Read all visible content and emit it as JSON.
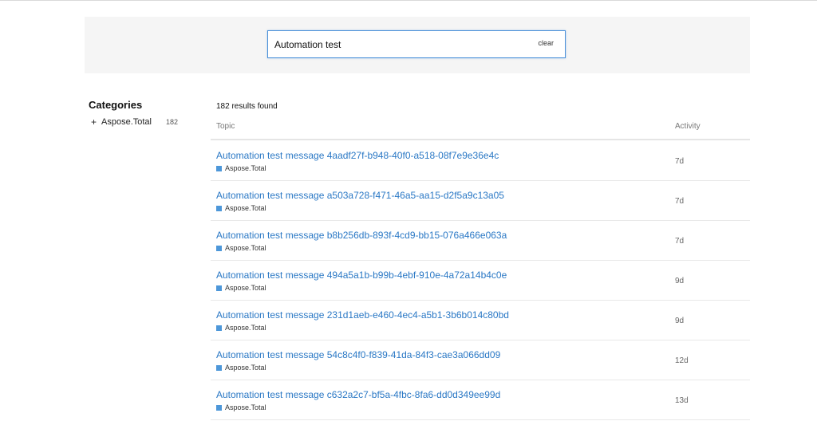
{
  "search": {
    "value": "Automation test",
    "clear_label": "clear"
  },
  "sidebar": {
    "title": "Categories",
    "categories": [
      {
        "label": "Aspose.Total",
        "count": "182"
      }
    ]
  },
  "results": {
    "count_text": "182 results found",
    "columns": {
      "topic": "Topic",
      "activity": "Activity"
    },
    "rows": [
      {
        "title": "Automation test message 4aadf27f-b948-40f0-a518-08f7e9e36e4c",
        "category": "Aspose.Total",
        "activity": "7d"
      },
      {
        "title": "Automation test message a503a728-f471-46a5-aa15-d2f5a9c13a05",
        "category": "Aspose.Total",
        "activity": "7d"
      },
      {
        "title": "Automation test message b8b256db-893f-4cd9-bb15-076a466e063a",
        "category": "Aspose.Total",
        "activity": "7d"
      },
      {
        "title": "Automation test message 494a5a1b-b99b-4ebf-910e-4a72a14b4c0e",
        "category": "Aspose.Total",
        "activity": "9d"
      },
      {
        "title": "Automation test message 231d1aeb-e460-4ec4-a5b1-3b6b014c80bd",
        "category": "Aspose.Total",
        "activity": "9d"
      },
      {
        "title": "Automation test message 54c8c4f0-f839-41da-84f3-cae3a066dd09",
        "category": "Aspose.Total",
        "activity": "12d"
      },
      {
        "title": "Automation test message c632a2c7-bf5a-4fbc-8fa6-dd0d349ee99d",
        "category": "Aspose.Total",
        "activity": "13d"
      }
    ]
  },
  "colors": {
    "link": "#2a78c5",
    "category_swatch": "#4d97d9",
    "search_border": "#4a90d9",
    "panel_bg": "#f5f5f5"
  },
  "icons": {
    "category_expand": "plus-icon",
    "category_marker": "square-swatch"
  }
}
